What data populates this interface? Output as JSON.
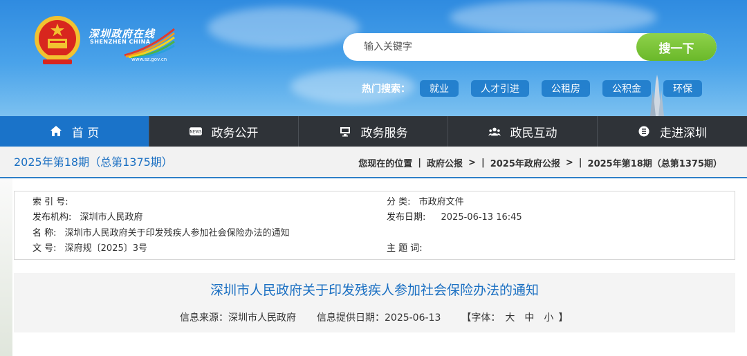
{
  "header": {
    "logo": {
      "cn": "深圳政府在线",
      "en": "SHENZHEN CHINA",
      "url": "www.sz.gov.cn"
    },
    "search": {
      "placeholder": "输入关键字",
      "button": "搜一下"
    },
    "hot": {
      "label": "热门搜索：",
      "tags": [
        "就业",
        "人才引进",
        "公租房",
        "公积金",
        "环保"
      ]
    }
  },
  "nav": {
    "items": [
      {
        "label": "首 页",
        "icon": "home-icon"
      },
      {
        "label": "政务公开",
        "icon": "news-icon"
      },
      {
        "label": "政务服务",
        "icon": "monitor-icon"
      },
      {
        "label": "政民互动",
        "icon": "people-icon"
      },
      {
        "label": "走进深圳",
        "icon": "info-circle-icon"
      }
    ]
  },
  "breadcrumb": {
    "issue": "2025年第18期（总第1375期）",
    "location_label": "您现在的位置",
    "items": [
      "政府公报",
      "2025年政府公报",
      "2025年第18期（总第1375期）"
    ],
    "sep": ">"
  },
  "info": {
    "index_label": "索 引 号:",
    "index_value": "",
    "category_label": "分 类:",
    "category_value": "市政府文件",
    "publisher_label": "发布机构:",
    "publisher_value": "深圳市人民政府",
    "date_label": "发布日期:",
    "date_value": "2025-06-13 16:45",
    "name_label": "名 称:",
    "name_value": "深圳市人民政府关于印发残疾人参加社会保险办法的通知",
    "docno_label": "文 号:",
    "docno_value": "深府规〔2025〕3号",
    "keywords_label": "主 题 词:",
    "keywords_value": ""
  },
  "article": {
    "title": "深圳市人民政府关于印发残疾人参加社会保险办法的通知",
    "source": "信息来源：深圳市人民政府",
    "provide_date": "信息提供日期：2025-06-13",
    "font_label": "【字体：",
    "font_large": "大",
    "font_medium": "中",
    "font_small": "小",
    "font_close": "】"
  },
  "colors": {
    "accent": "#1a73c9",
    "nav_bg": "#2f3338",
    "search_button": "#7cc63a"
  }
}
